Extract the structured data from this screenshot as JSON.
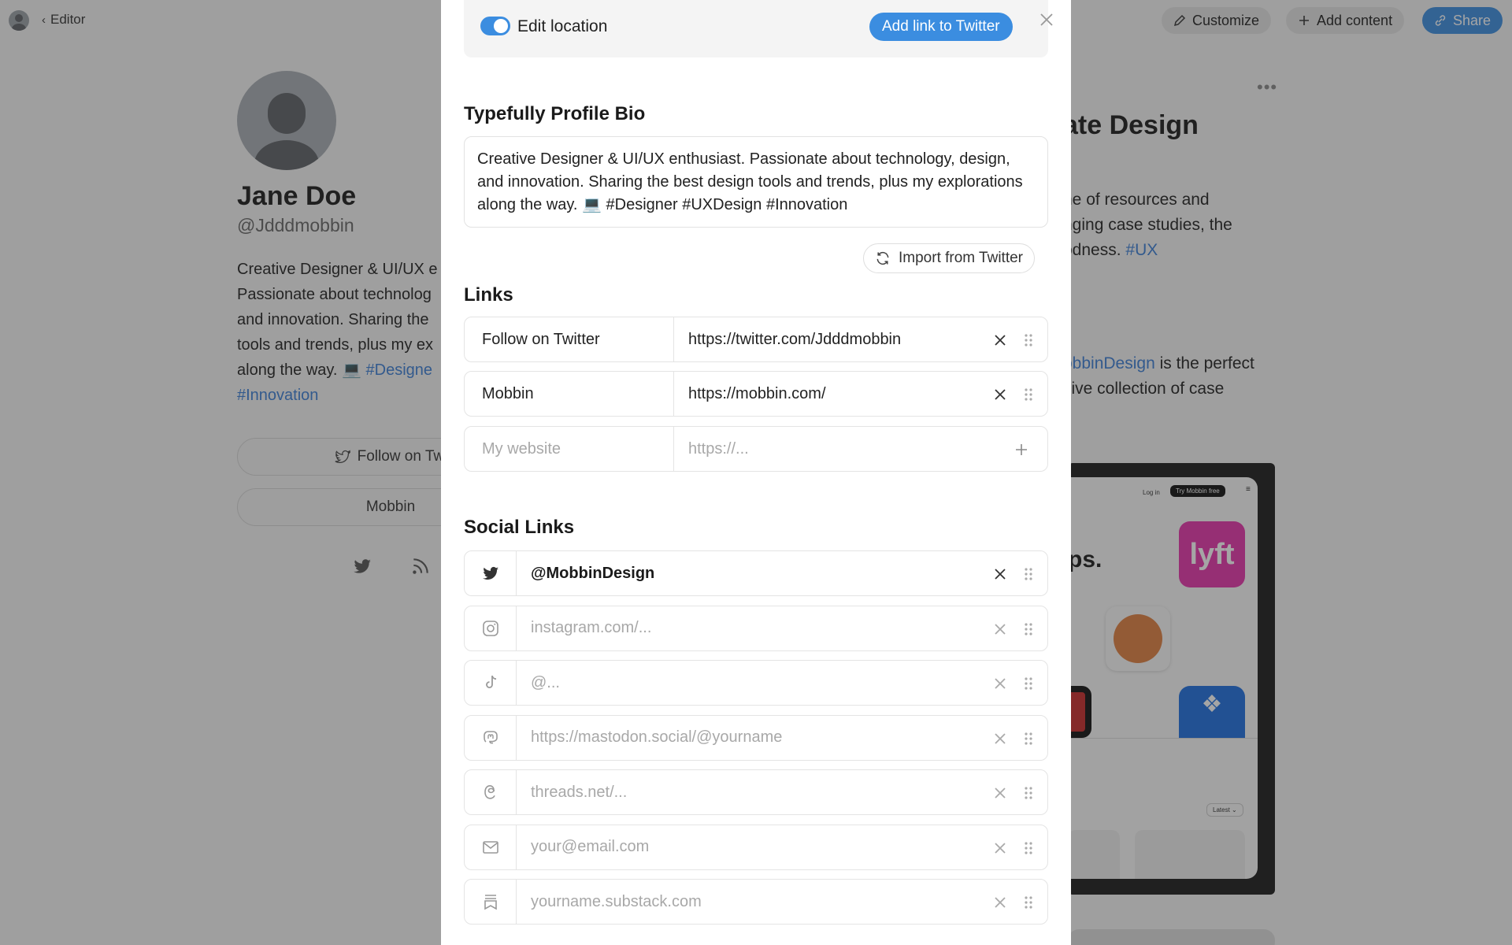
{
  "topbar": {
    "editor_label": "Editor",
    "customize_label": "Customize",
    "add_content_label": "Add content",
    "share_label": "Share"
  },
  "profile": {
    "name": "Jane Doe",
    "handle": "@Jdddmobbin",
    "bio_lines": [
      "Creative Designer & UI/UX e",
      "Passionate about technolog",
      "and innovation. Sharing the",
      "tools and trends, plus my ex",
      "along the way. 💻 "
    ],
    "bio_tag1": "#Designe",
    "bio_tag2": "#Innovation",
    "link1": "Follow on Twi",
    "link2": "Mobbin"
  },
  "right_card": {
    "title": "ate Design",
    "text1_lines": [
      "ne of resources and",
      "nging case studies, the",
      "odness. "
    ],
    "text1_tag": "#UX",
    "text2_tag": "obbinDesign",
    "text2_rest": " is the perfect",
    "text2_line2": "sive collection of case",
    "device": {
      "login": "Log in",
      "try": "Try Mobbin free",
      "heading": "ps.",
      "latest": "Latest ⌄",
      "brand_colors": {
        "lyft": "#e535ab",
        "dropbox": "#1e6fe0",
        "orange": "#e08040"
      }
    }
  },
  "modal": {
    "location_toggle_label": "Edit location",
    "location_toggle_on": true,
    "add_link_button": "Add link to Twitter",
    "bio_section_title": "Typefully Profile Bio",
    "bio_text": "Creative Designer & UI/UX enthusiast. Passionate about technology, design, and innovation. Sharing the best design tools and trends, plus my explorations along the way. 💻 #Designer #UXDesign #Innovation",
    "import_button": "Import from Twitter",
    "links_section_title": "Links",
    "links": [
      {
        "title": "Follow on Twitter",
        "url": "https://twitter.com/Jdddmobbin"
      },
      {
        "title": "Mobbin",
        "url": "https://mobbin.com/"
      }
    ],
    "new_link": {
      "title_placeholder": "My website",
      "url_placeholder": "https://..."
    },
    "social_section_title": "Social Links",
    "social_links": [
      {
        "icon": "twitter-icon",
        "value": "@MobbinDesign",
        "filled": true
      },
      {
        "icon": "instagram-icon",
        "value": "instagram.com/...",
        "filled": false
      },
      {
        "icon": "tiktok-icon",
        "value": "@...",
        "filled": false
      },
      {
        "icon": "mastodon-icon",
        "value": "https://mastodon.social/@yourname",
        "filled": false
      },
      {
        "icon": "threads-icon",
        "value": "threads.net/...",
        "filled": false
      },
      {
        "icon": "email-icon",
        "value": "your@email.com",
        "filled": false
      },
      {
        "icon": "substack-icon",
        "value": "yourname.substack.com",
        "filled": false
      }
    ]
  },
  "colors": {
    "accent": "#3b8de0",
    "hashtag": "#3b7ed6"
  }
}
